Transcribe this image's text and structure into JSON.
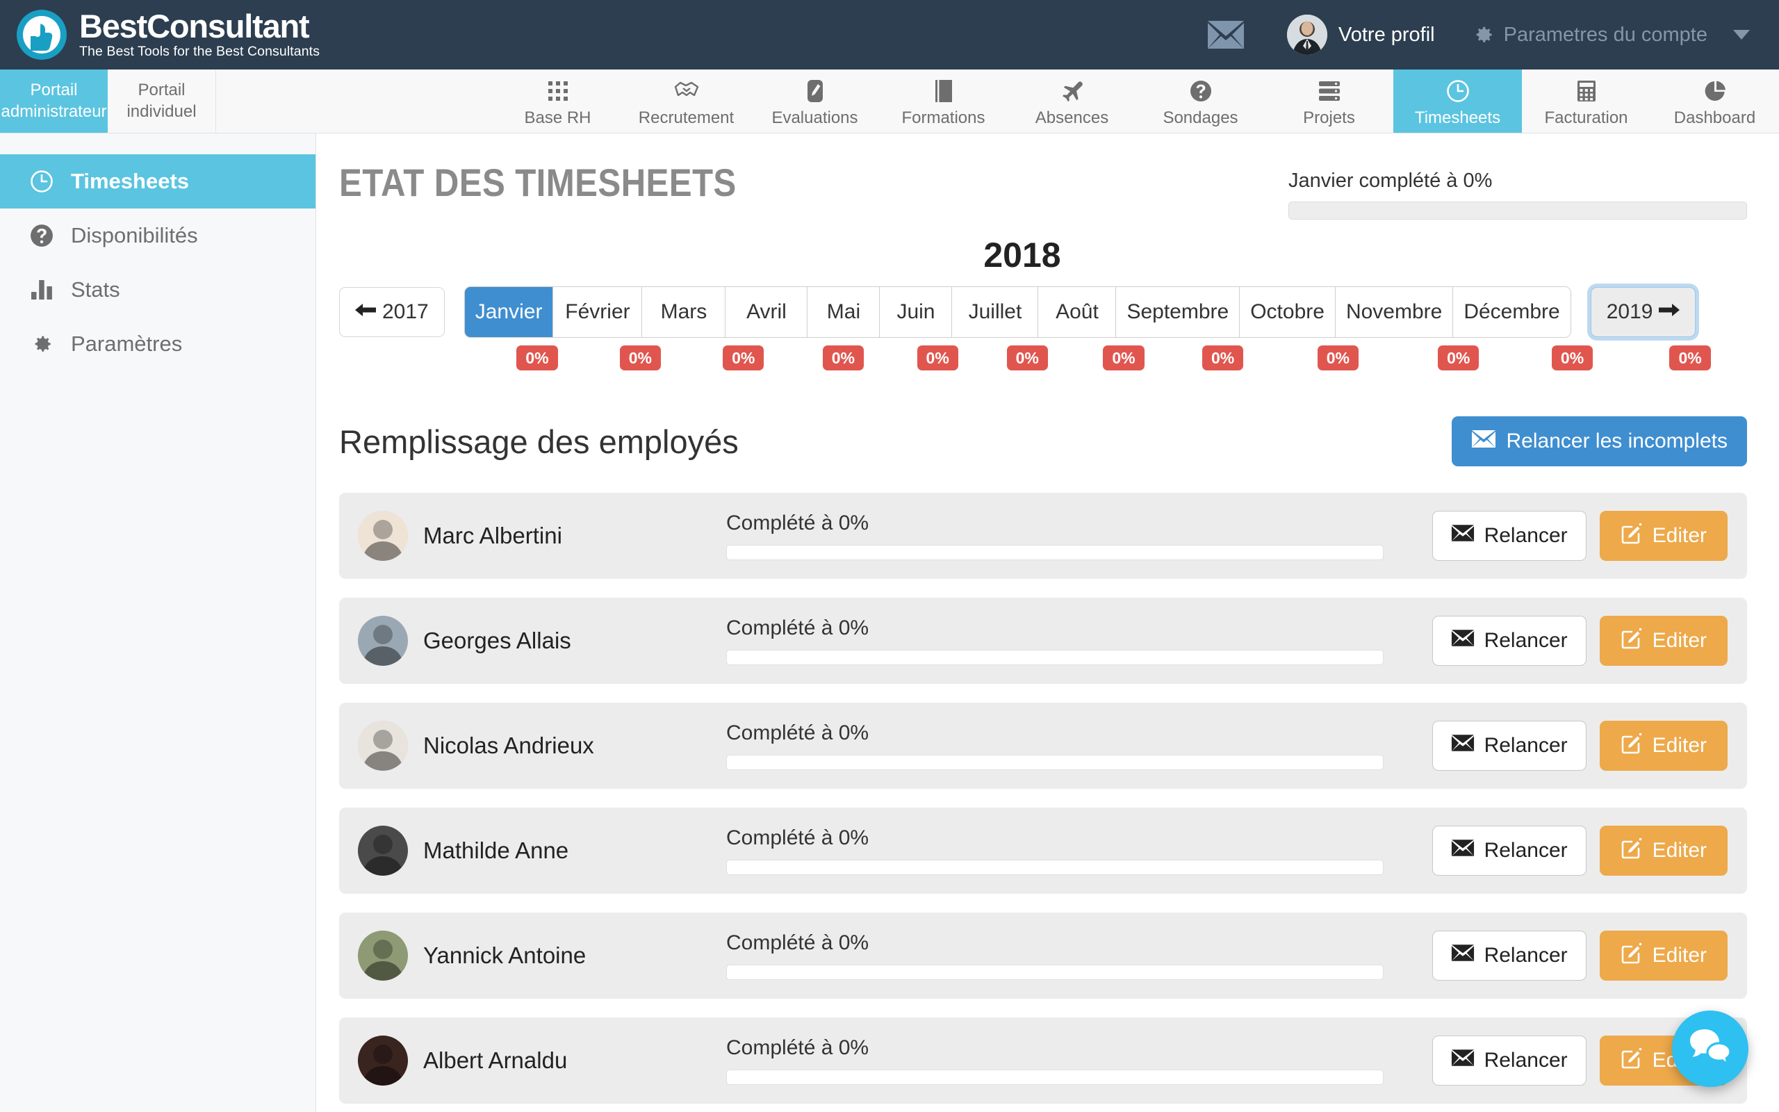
{
  "brand": {
    "name": "BestConsultant",
    "tagline": "The Best Tools for the Best Consultants"
  },
  "topbar": {
    "mail_icon": "envelope-icon",
    "profile_label": "Votre profil",
    "settings_label": "Parametres du compte",
    "settings_icon": "gear-icon",
    "caret_icon": "caret-down-icon"
  },
  "portal_tabs": [
    {
      "line1": "Portail",
      "line2": "administrateur",
      "active": true
    },
    {
      "line1": "Portail",
      "line2": "individuel",
      "active": false
    }
  ],
  "nav": [
    {
      "label": "Base RH",
      "icon": "grid-icon",
      "active": false
    },
    {
      "label": "Recrutement",
      "icon": "handshake-icon",
      "active": false
    },
    {
      "label": "Evaluations",
      "icon": "pencil-note-icon",
      "active": false
    },
    {
      "label": "Formations",
      "icon": "book-icon",
      "active": false
    },
    {
      "label": "Absences",
      "icon": "airplane-icon",
      "active": false
    },
    {
      "label": "Sondages",
      "icon": "question-circle-icon",
      "active": false
    },
    {
      "label": "Projets",
      "icon": "server-list-icon",
      "active": false
    },
    {
      "label": "Timesheets",
      "icon": "clock-icon",
      "active": true
    },
    {
      "label": "Facturation",
      "icon": "calculator-icon",
      "active": false
    },
    {
      "label": "Dashboard",
      "icon": "pie-chart-icon",
      "active": false
    }
  ],
  "sidebar": {
    "items": [
      {
        "label": "Timesheets",
        "icon": "clock-icon",
        "active": true
      },
      {
        "label": "Disponibilités",
        "icon": "question-circle-icon",
        "active": false
      },
      {
        "label": "Stats",
        "icon": "bar-chart-icon",
        "active": false
      },
      {
        "label": "Paramètres",
        "icon": "gear-icon",
        "active": false
      }
    ]
  },
  "page": {
    "title": "ETAT DES TIMESHEETS",
    "month_summary_label": "Janvier complété à 0%",
    "month_summary_percent": 0,
    "year": "2018",
    "prev_year_label": "2017",
    "next_year_label": "2019",
    "prev_year_icon": "arrow-left-icon",
    "next_year_icon": "arrow-right-icon",
    "months": [
      {
        "name": "Janvier",
        "badge": "0%",
        "active": true
      },
      {
        "name": "Février",
        "badge": "0%",
        "active": false
      },
      {
        "name": "Mars",
        "badge": "0%",
        "active": false
      },
      {
        "name": "Avril",
        "badge": "0%",
        "active": false
      },
      {
        "name": "Mai",
        "badge": "0%",
        "active": false
      },
      {
        "name": "Juin",
        "badge": "0%",
        "active": false
      },
      {
        "name": "Juillet",
        "badge": "0%",
        "active": false
      },
      {
        "name": "Août",
        "badge": "0%",
        "active": false
      },
      {
        "name": "Septembre",
        "badge": "0%",
        "active": false
      },
      {
        "name": "Octobre",
        "badge": "0%",
        "active": false
      },
      {
        "name": "Novembre",
        "badge": "0%",
        "active": false
      },
      {
        "name": "Décembre",
        "badge": "0%",
        "active": false
      }
    ]
  },
  "section": {
    "title": "Remplissage des employés",
    "relancer_all_label": "Relancer les incomplets",
    "relancer_all_icon": "envelope-icon"
  },
  "employees": [
    {
      "name": "Marc Albertini",
      "progress_label": "Complété à 0%",
      "percent": 0,
      "relancer_label": "Relancer",
      "editer_label": "Editer",
      "avatar_tone": "#efe3d6"
    },
    {
      "name": "Georges Allais",
      "progress_label": "Complété à 0%",
      "percent": 0,
      "relancer_label": "Relancer",
      "editer_label": "Editer",
      "avatar_tone": "#9aa8b4"
    },
    {
      "name": "Nicolas Andrieux",
      "progress_label": "Complété à 0%",
      "percent": 0,
      "relancer_label": "Relancer",
      "editer_label": "Editer",
      "avatar_tone": "#e8e3dd"
    },
    {
      "name": "Mathilde Anne",
      "progress_label": "Complété à 0%",
      "percent": 0,
      "relancer_label": "Relancer",
      "editer_label": "Editer",
      "avatar_tone": "#4a4a4a"
    },
    {
      "name": "Yannick Antoine",
      "progress_label": "Complété à 0%",
      "percent": 0,
      "relancer_label": "Relancer",
      "editer_label": "Editer",
      "avatar_tone": "#8d9a74"
    },
    {
      "name": "Albert Arnaldu",
      "progress_label": "Complété à 0%",
      "percent": 0,
      "relancer_label": "Relancer",
      "editer_label": "Editer",
      "avatar_tone": "#3a2420"
    }
  ],
  "chat": {
    "icon": "chat-bubbles-icon"
  },
  "colors": {
    "header_bg": "#2c3e50",
    "accent_cyan": "#5bc4e0",
    "accent_blue": "#3f8ed0",
    "badge_red": "#e0564f",
    "edit_orange": "#eda94a",
    "chat_cyan": "#2ec0f0"
  }
}
